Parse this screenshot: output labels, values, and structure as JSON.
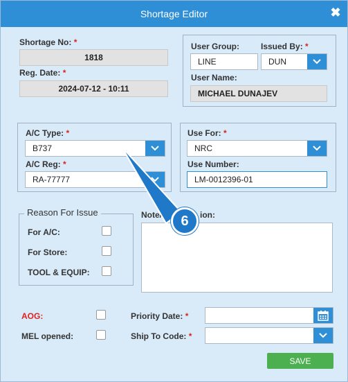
{
  "window": {
    "title": "Shortage Editor"
  },
  "header": {
    "shortage_no": {
      "label": "Shortage No:",
      "value": "1818"
    },
    "reg_date": {
      "label": "Reg. Date:",
      "value": "2024-07-12 - 10:11"
    }
  },
  "user_panel": {
    "user_group": {
      "label": "User Group:",
      "value": "LINE"
    },
    "issued_by": {
      "label": "Issued By:",
      "value": "DUN"
    },
    "user_name": {
      "label": "User Name:",
      "value": "MICHAEL DUNAJEV"
    }
  },
  "ac_panel": {
    "ac_type": {
      "label": "A/C Type:",
      "value": "B737"
    },
    "ac_reg": {
      "label": "A/C Reg:",
      "value": "RA-77777"
    }
  },
  "use_panel": {
    "use_for": {
      "label": "Use For:",
      "value": "NRC"
    },
    "use_number": {
      "label": "Use Number:",
      "value": "LM-0012396-01"
    }
  },
  "reason": {
    "legend": "Reason For Issue",
    "for_ac": "For A/C:",
    "for_store": "For Store:",
    "tool_equip": "TOOL & EQUIP:"
  },
  "note": {
    "label": "Note/Description:",
    "visible_start": "Note/D",
    "visible_end": "ion:"
  },
  "bottom": {
    "aog": "AOG:",
    "mel_opened": "MEL opened:",
    "priority_date": "Priority Date:",
    "ship_to_code": "Ship To Code:"
  },
  "buttons": {
    "save": "SAVE"
  },
  "required_mark": "*",
  "step_badge": "6",
  "colors": {
    "title_bar": "#2e8fd6",
    "save_button": "#4caf50",
    "required": "#dd2222"
  }
}
